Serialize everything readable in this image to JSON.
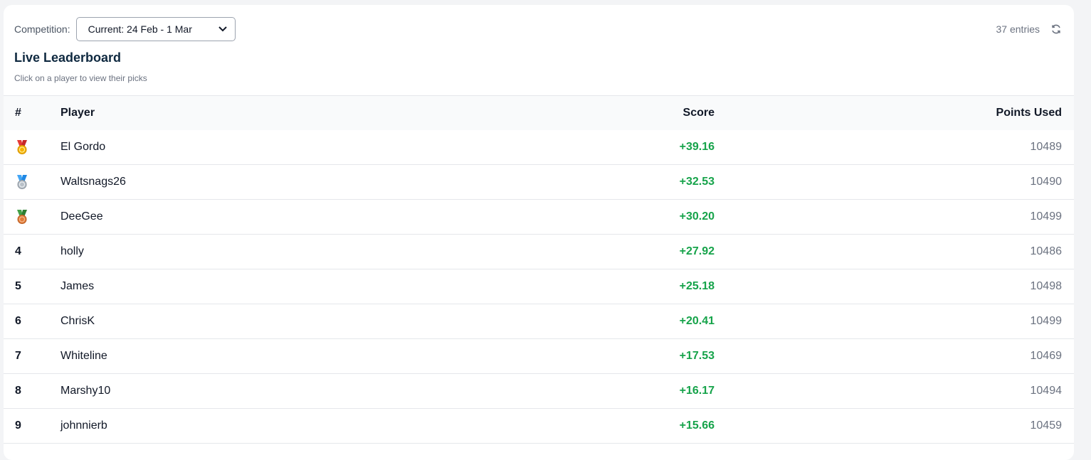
{
  "header": {
    "competition_label": "Competition:",
    "competition_selected": "Current: 24 Feb - 1 Mar",
    "entries": "37 entries",
    "title": "Live Leaderboard",
    "subtitle": "Click on a player to view their picks"
  },
  "table": {
    "columns": {
      "rank": "#",
      "player": "Player",
      "score": "Score",
      "points": "Points Used"
    },
    "rows": [
      {
        "rank": "",
        "medal": "gold-medal-icon",
        "player": "El Gordo",
        "score": "+39.16",
        "points": "10489"
      },
      {
        "rank": "",
        "medal": "silver-medal-icon",
        "player": "Waltsnags26",
        "score": "+32.53",
        "points": "10490"
      },
      {
        "rank": "",
        "medal": "bronze-medal-icon",
        "player": "DeeGee",
        "score": "+30.20",
        "points": "10499"
      },
      {
        "rank": "4",
        "player": "holly",
        "score": "+27.92",
        "points": "10486"
      },
      {
        "rank": "5",
        "player": "James",
        "score": "+25.18",
        "points": "10498"
      },
      {
        "rank": "6",
        "player": "ChrisK",
        "score": "+20.41",
        "points": "10499"
      },
      {
        "rank": "7",
        "player": "Whiteline",
        "score": "+17.53",
        "points": "10469"
      },
      {
        "rank": "8",
        "player": "Marshy10",
        "score": "+16.17",
        "points": "10494"
      },
      {
        "rank": "9",
        "player": "johnnierb",
        "score": "+15.66",
        "points": "10459"
      }
    ]
  },
  "colors": {
    "score_positive": "#16a34a",
    "title": "#0f2940",
    "gold": "#f5b301",
    "silver": "#b8c0c8",
    "bronze": "#e07b39"
  }
}
